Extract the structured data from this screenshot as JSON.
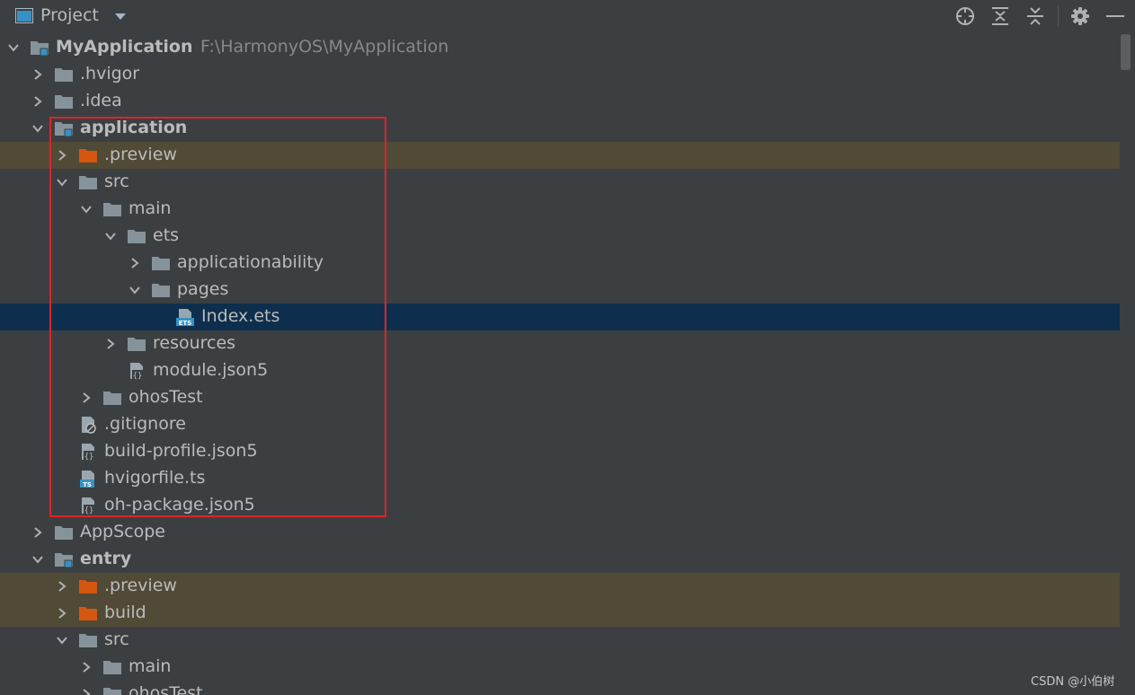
{
  "panel": {
    "title": "Project"
  },
  "tree": [
    {
      "name": "MyApplication",
      "path": "F:\\HarmonyOS\\MyApplication",
      "depth": 0,
      "expanded": true,
      "type": "module",
      "bold": true
    },
    {
      "name": ".hvigor",
      "depth": 1,
      "expanded": false,
      "type": "folder"
    },
    {
      "name": ".idea",
      "depth": 1,
      "expanded": false,
      "type": "folder"
    },
    {
      "name": "application",
      "depth": 1,
      "expanded": true,
      "type": "module",
      "bold": true
    },
    {
      "name": ".preview",
      "depth": 2,
      "expanded": false,
      "type": "folder-excluded",
      "highlight": "orange"
    },
    {
      "name": "src",
      "depth": 2,
      "expanded": true,
      "type": "folder"
    },
    {
      "name": "main",
      "depth": 3,
      "expanded": true,
      "type": "folder"
    },
    {
      "name": "ets",
      "depth": 4,
      "expanded": true,
      "type": "folder"
    },
    {
      "name": "applicationability",
      "depth": 5,
      "expanded": false,
      "type": "folder"
    },
    {
      "name": "pages",
      "depth": 5,
      "expanded": true,
      "type": "folder"
    },
    {
      "name": "Index.ets",
      "depth": 6,
      "type": "file-ets",
      "selected": true
    },
    {
      "name": "resources",
      "depth": 4,
      "expanded": false,
      "type": "folder"
    },
    {
      "name": "module.json5",
      "depth": 4,
      "type": "file-json"
    },
    {
      "name": "ohosTest",
      "depth": 3,
      "expanded": false,
      "type": "folder"
    },
    {
      "name": ".gitignore",
      "depth": 2,
      "type": "file-ignore"
    },
    {
      "name": "build-profile.json5",
      "depth": 2,
      "type": "file-json"
    },
    {
      "name": "hvigorfile.ts",
      "depth": 2,
      "type": "file-ts"
    },
    {
      "name": "oh-package.json5",
      "depth": 2,
      "type": "file-json"
    },
    {
      "name": "AppScope",
      "depth": 1,
      "expanded": false,
      "type": "folder"
    },
    {
      "name": "entry",
      "depth": 1,
      "expanded": true,
      "type": "module",
      "bold": true
    },
    {
      "name": ".preview",
      "depth": 2,
      "expanded": false,
      "type": "folder-excluded",
      "highlight": "orange"
    },
    {
      "name": "build",
      "depth": 2,
      "expanded": false,
      "type": "folder-excluded",
      "highlight": "orange"
    },
    {
      "name": "src",
      "depth": 2,
      "expanded": true,
      "type": "folder"
    },
    {
      "name": "main",
      "depth": 3,
      "expanded": false,
      "type": "folder"
    },
    {
      "name": "ohosTest",
      "depth": 3,
      "expanded": false,
      "type": "folder"
    }
  ],
  "toolbar_icons": [
    "locate-icon",
    "expand-all-icon",
    "collapse-all-icon",
    "gear-icon",
    "minimize-icon"
  ],
  "colors": {
    "background": "#3c3f41",
    "selected_row": "#0d2f4d",
    "excluded_row": "#514a37",
    "folder": "#87939a",
    "excluded_folder": "#d4560f",
    "module_marker": "#3592c4",
    "annotation_border": "#e0222a"
  },
  "watermark": "CSDN @小伯树"
}
